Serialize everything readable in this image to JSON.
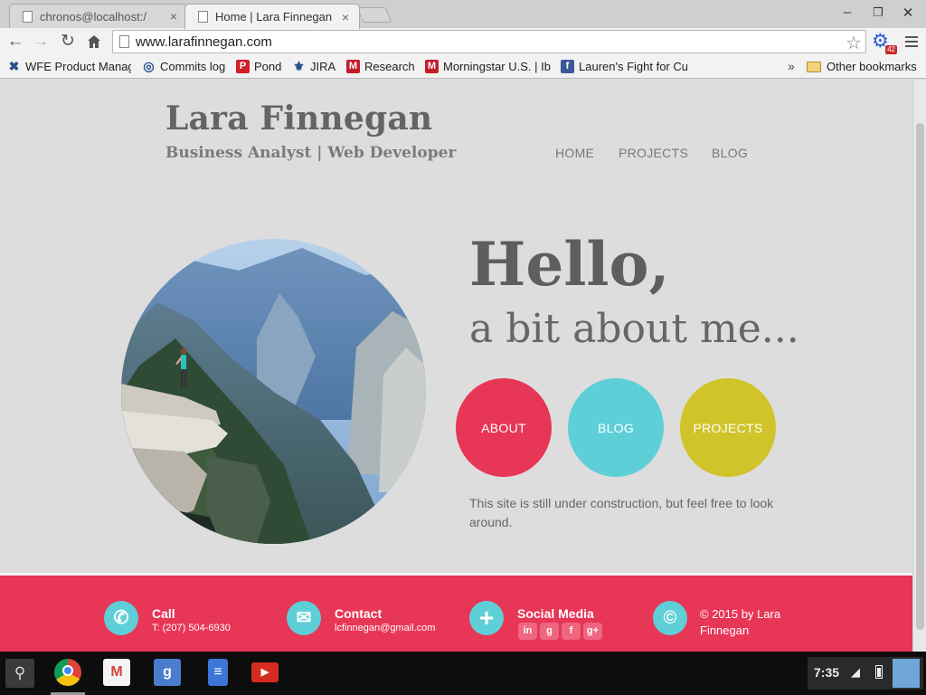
{
  "browser": {
    "tabs": [
      {
        "title": "chronos@localhost:/",
        "active": false
      },
      {
        "title": "Home | Lara Finnegan",
        "active": true
      }
    ],
    "window_controls": {
      "minimize": "–",
      "restore": "❐",
      "close": "✕"
    },
    "address": "www.larafinnegan.com",
    "extension_badge": "42",
    "bookmarks": [
      {
        "label": "WFE Product Manage",
        "icon": "tools-icon",
        "color": "#2b4f8a"
      },
      {
        "label": "Commits log",
        "icon": "target-icon",
        "color": "#2b4f8a"
      },
      {
        "label": "Pond",
        "icon": "p-icon",
        "color": "#d0202a"
      },
      {
        "label": "JIRA",
        "icon": "jira-icon",
        "color": "#1f4b88"
      },
      {
        "label": "Research",
        "icon": "m-icon",
        "color": "#c21e2a"
      },
      {
        "label": "Morningstar U.S. | Ibb",
        "icon": "m-icon",
        "color": "#c21e2a"
      },
      {
        "label": "Lauren's Fight for Cur",
        "icon": "facebook-icon",
        "color": "#3b5998"
      }
    ],
    "bookmarks_overflow": "»",
    "other_bookmarks": "Other bookmarks"
  },
  "site": {
    "name": "Lara Finnegan",
    "tagline": "Business Analyst | Web Developer",
    "nav": [
      "HOME",
      "PROJECTS",
      "BLOG"
    ],
    "hero": {
      "heading": "Hello,",
      "subheading": "a bit about me...",
      "buttons": [
        {
          "label": "ABOUT",
          "color": "#e73656"
        },
        {
          "label": "BLOG",
          "color": "#5fcfd7"
        },
        {
          "label": "PROJECTS",
          "color": "#d1c32a"
        }
      ],
      "blurb": "This site is still under construction, but feel free to look around."
    },
    "footer": {
      "call": {
        "title": "Call",
        "text": "T: (207) 504-6930"
      },
      "contact": {
        "title": "Contact",
        "text": "lcfinnegan@gmail.com"
      },
      "social": {
        "title": "Social Media",
        "icons": [
          "in",
          "g",
          "f",
          "g+"
        ]
      },
      "copyright": "© 2015 by Lara Finnegan"
    }
  },
  "shelf": {
    "apps": [
      "chrome-icon",
      "gmail-icon",
      "google-search-icon",
      "docs-icon",
      "youtube-icon"
    ],
    "time": "7:35"
  },
  "colors": {
    "accent_red": "#e73656",
    "accent_cyan": "#5fcfd7",
    "accent_yellow": "#d1c32a"
  }
}
